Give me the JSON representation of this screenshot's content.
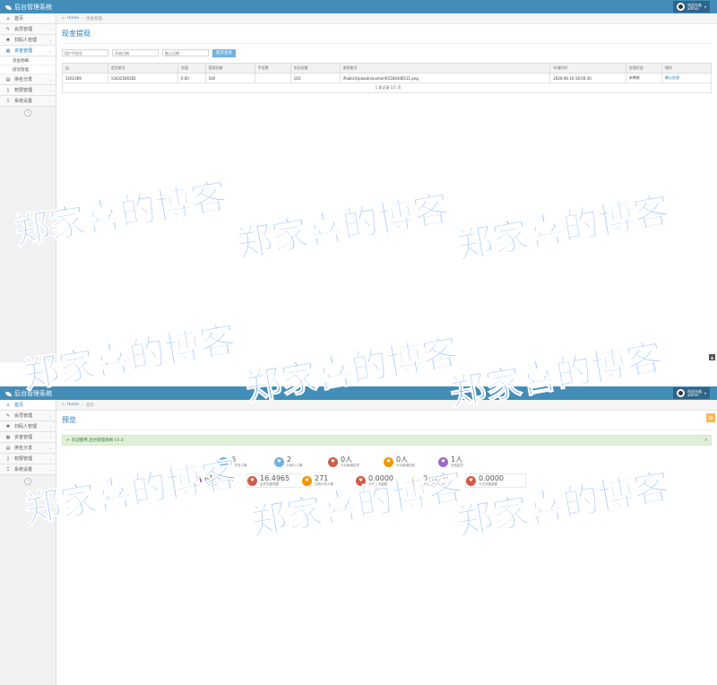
{
  "screen1": {
    "header": {
      "brand": "后台管理系统",
      "user_line1": "欢迎光临",
      "user_line2": "admin"
    },
    "sidebar": {
      "items": [
        {
          "icon": "⌂",
          "label": "首页"
        },
        {
          "icon": "✎",
          "label": "会员管理"
        },
        {
          "icon": "✱",
          "label": "扫码人管理"
        },
        {
          "icon": "▦",
          "label": "资金管理"
        },
        {
          "icon": "▤",
          "label": "排名分发"
        },
        {
          "icon": "▯",
          "label": "权限管理"
        },
        {
          "icon": "⌶",
          "label": "系统设置"
        }
      ],
      "sub_items": [
        "资金明细",
        "提现管理"
      ]
    },
    "breadcrumb": {
      "home": "Home",
      "current": "资金管理"
    },
    "title": "现金提现",
    "filters": {
      "phone_placeholder": "用户手机号",
      "start_placeholder": "开始日期",
      "end_placeholder": "截止日期",
      "button": "提交查询"
    },
    "table": {
      "headers": [
        "ID",
        "会员账号",
        "充值",
        "管理金额",
        "手续费",
        "实际金额",
        "收款账号",
        "申请时间",
        "处理状态",
        "操作"
      ],
      "rows": [
        [
          "1261369",
          "13432566565",
          "0.00",
          "100",
          "",
          "163",
          "/Public/Upload/voucher/61564306511.png",
          "2020-06-16 18:00:30",
          "未审核",
          "确认处理"
        ]
      ],
      "pager": "1 条记录 1/1 页"
    }
  },
  "screen2": {
    "header": {
      "brand": "后台管理系统",
      "user_line1": "欢迎光临",
      "user_line2": "admin"
    },
    "sidebar": {
      "items": [
        {
          "icon": "⌂",
          "label": "首页"
        },
        {
          "icon": "✎",
          "label": "会员管理"
        },
        {
          "icon": "✱",
          "label": "扫码人管理"
        },
        {
          "icon": "▦",
          "label": "资金管理"
        },
        {
          "icon": "▤",
          "label": "排名分发"
        },
        {
          "icon": "▯",
          "label": "权限管理"
        },
        {
          "icon": "⌶",
          "label": "系统设置"
        }
      ]
    },
    "breadcrumb": {
      "home": "Home",
      "current": "首页"
    },
    "title": "预览",
    "alert": "欢迎使用 后台管理系统 V1.0",
    "stats": [
      {
        "value": "6",
        "label": "会员总人数",
        "color": "#6fb3e0"
      },
      {
        "value": "2",
        "label": "扫码人人数",
        "color": "#6fb3e0"
      },
      {
        "value": "0人",
        "label": "今日新增会员",
        "color": "#d15b47"
      },
      {
        "value": "0人",
        "label": "今日新增扫码",
        "color": "#f89406"
      },
      {
        "value": "1人",
        "label": "在线会员",
        "color": "#a069c3"
      },
      {
        "value": "8186.85",
        "label": "会员总额",
        "color": "#a069c3"
      },
      {
        "value": "16.4965",
        "label": "会员充值总额",
        "color": "#d15b47"
      },
      {
        "value": "271",
        "label": "扫码人总人数",
        "color": "#f89406"
      },
      {
        "value": "0.0000",
        "label": "今日提现金额",
        "color": "#d15b47"
      },
      {
        "value": "0.0000",
        "label": "今日扫码人提现",
        "color": "#f89406"
      },
      {
        "value": "0.0000",
        "label": "今日充值金额",
        "color": "#d15b47"
      }
    ]
  },
  "watermark": "郑家喜的博客"
}
